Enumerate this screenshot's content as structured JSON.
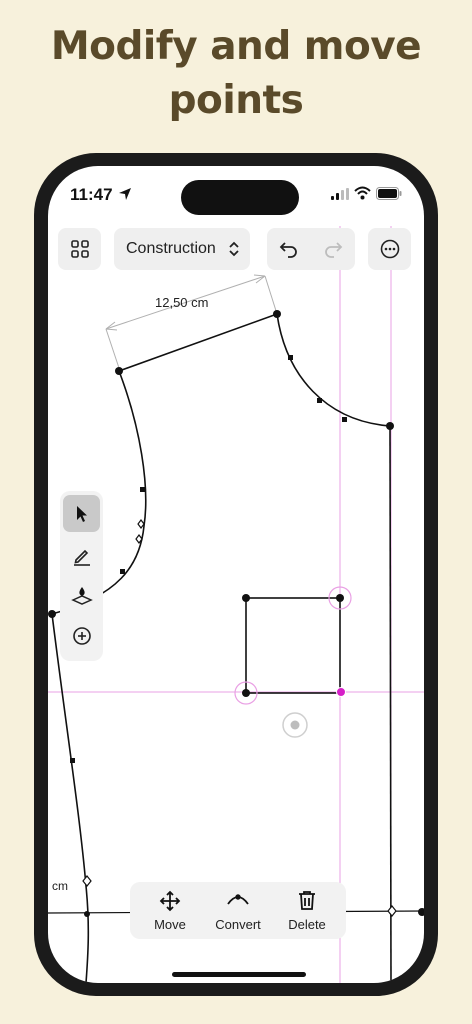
{
  "headline": {
    "line1": "Modify and move",
    "line2": "points"
  },
  "status": {
    "time": "11:47"
  },
  "toolbar": {
    "mode_label": "Construction"
  },
  "drawing": {
    "measurement": "12,50 cm",
    "unit_label": "cm"
  },
  "actions": {
    "move": "Move",
    "convert": "Convert",
    "delete": "Delete"
  },
  "colors": {
    "background": "#f7f1dc",
    "headline": "#5a4a2a",
    "guide": "#e06ad8",
    "selected_point": "#d61fc8"
  },
  "icons": [
    "location-arrow-icon",
    "signal-icon",
    "wifi-icon",
    "battery-icon",
    "grid-icon",
    "chevron-up-down-icon",
    "undo-icon",
    "redo-icon",
    "ellipsis-icon",
    "cursor-icon",
    "pencil-icon",
    "curve-tool-icon",
    "add-point-icon",
    "move-arrows-icon",
    "convert-curve-icon",
    "trash-icon"
  ]
}
